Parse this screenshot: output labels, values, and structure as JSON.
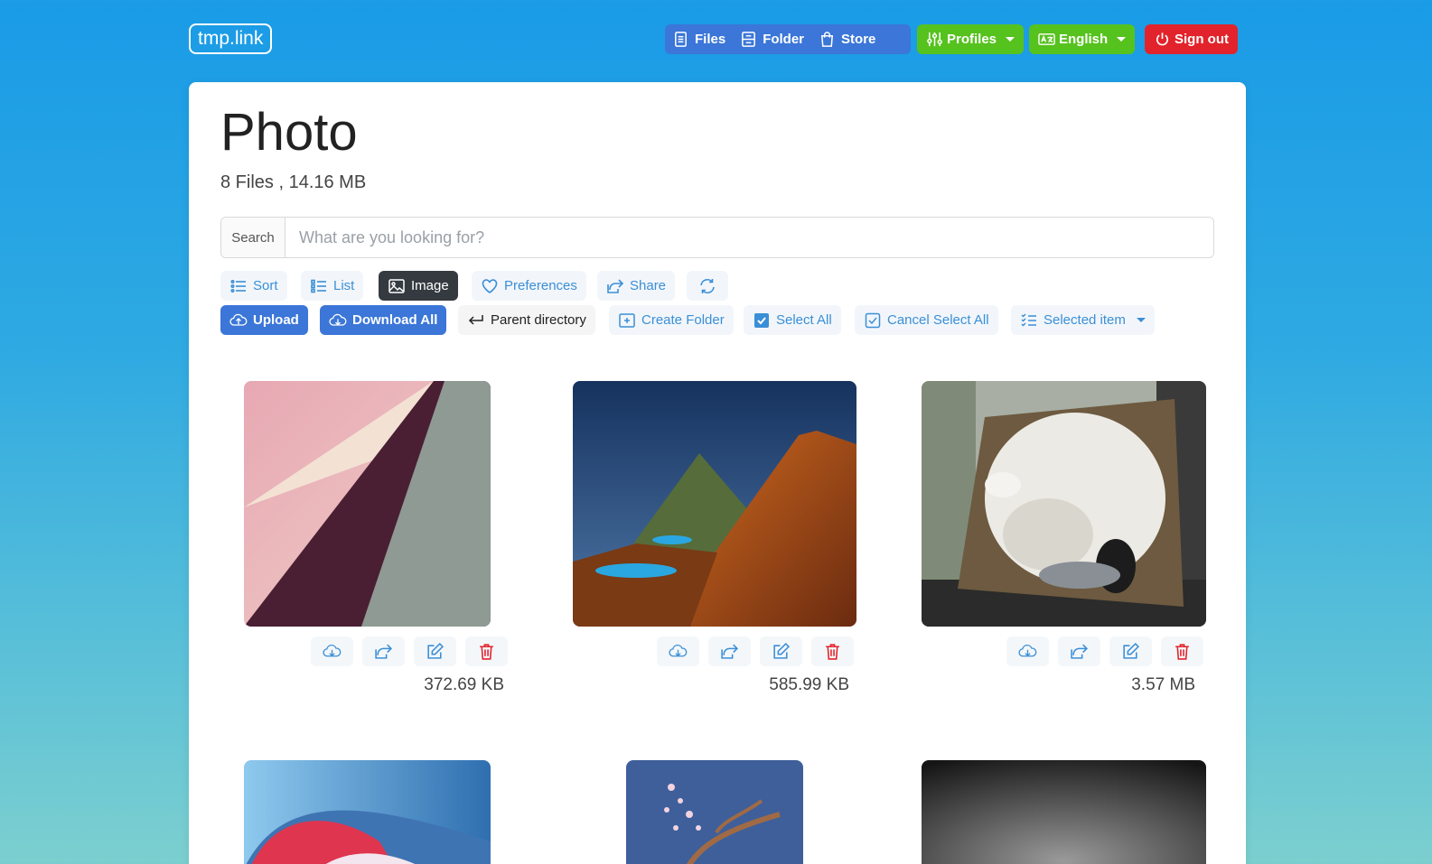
{
  "header": {
    "logo": "tmp.link",
    "nav": [
      {
        "label": "Files",
        "icon": "files-icon"
      },
      {
        "label": "Folder",
        "icon": "folder-icon"
      },
      {
        "label": "Store",
        "icon": "store-bag-icon"
      }
    ],
    "profiles": "Profiles",
    "language": "English",
    "signout": "Sign out"
  },
  "page": {
    "title": "Photo",
    "subtitle": "8 Files , 14.16 MB"
  },
  "search": {
    "label": "Search",
    "placeholder": "What are you looking for?",
    "value": ""
  },
  "toolbar1": {
    "sort": "Sort",
    "list": "List",
    "image": "Image",
    "preferences": "Preferences",
    "share": "Share"
  },
  "toolbar2": {
    "upload": "Upload",
    "download_all": "Download All",
    "parent_directory": "Parent directory",
    "create_folder": "Create Folder",
    "select_all": "Select All",
    "cancel_select_all": "Cancel Select All",
    "selected_item": "Selected item"
  },
  "files": [
    {
      "size": "372.69 KB"
    },
    {
      "size": "585.99 KB"
    },
    {
      "size": "3.57 MB"
    },
    {
      "size": ""
    },
    {
      "size": ""
    },
    {
      "size": ""
    }
  ],
  "colors": {
    "accent": "#3b76d8",
    "success": "#56c21e",
    "danger": "#e2232b",
    "link": "#3b8fd6"
  }
}
